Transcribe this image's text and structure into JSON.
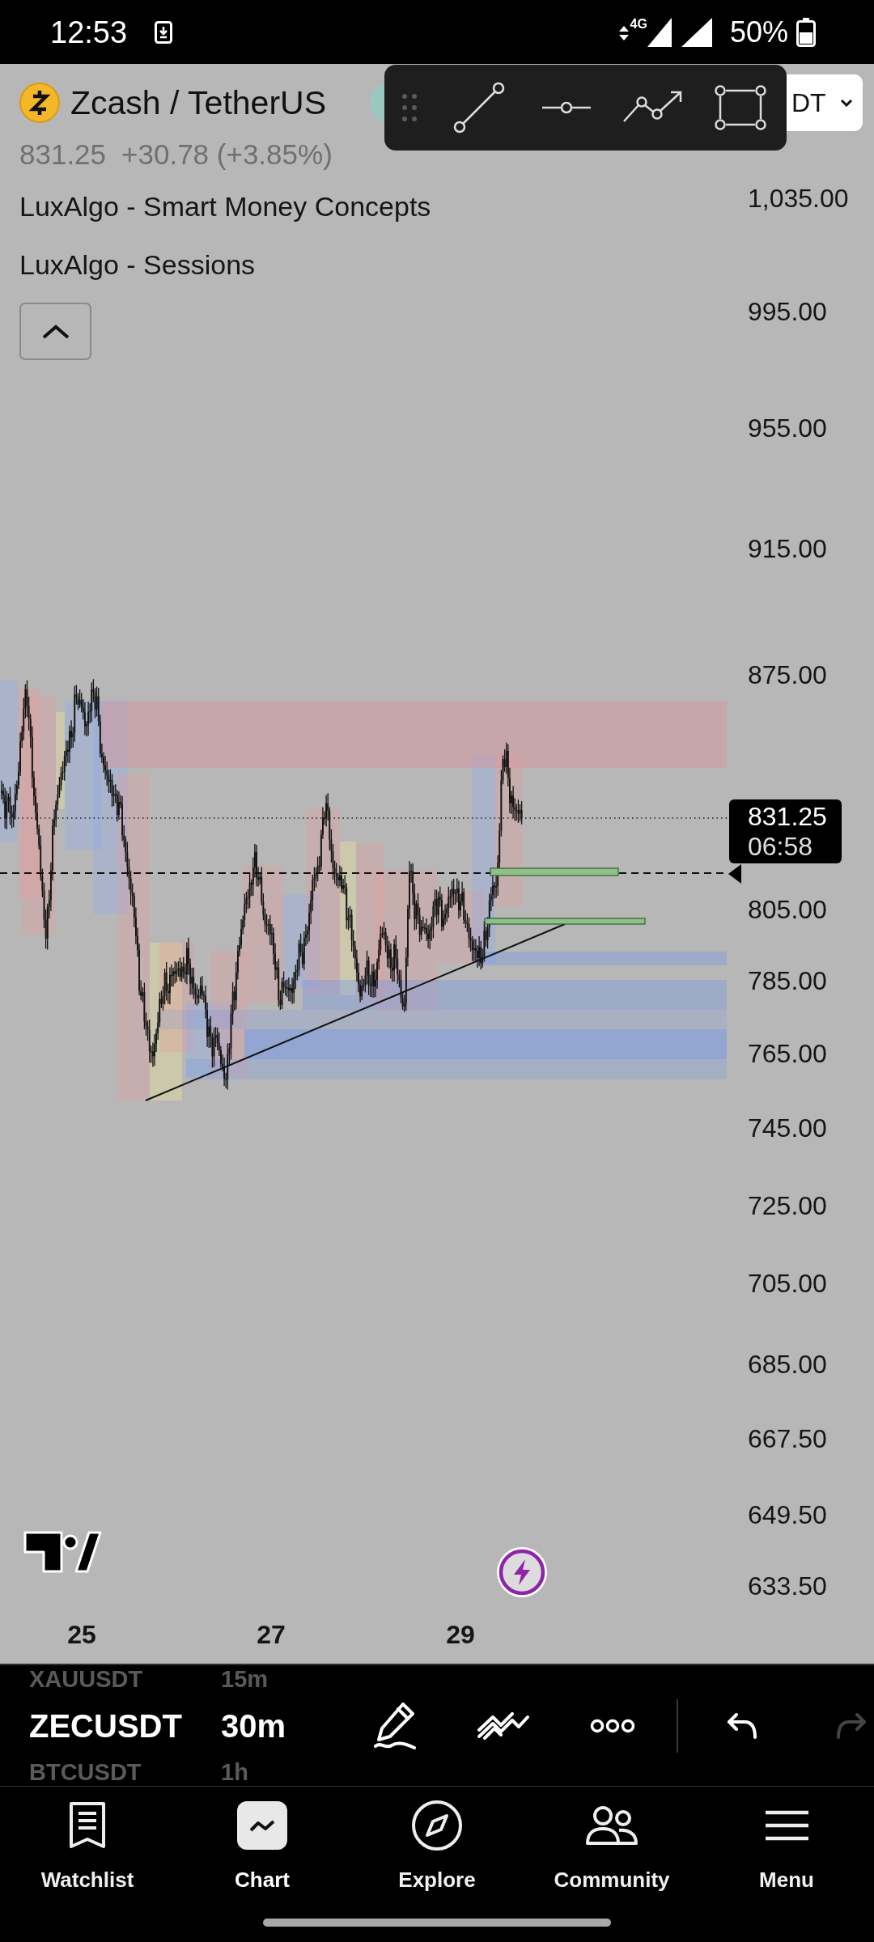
{
  "status_bar": {
    "time": "12:53",
    "network": "4G",
    "battery": "50%"
  },
  "header": {
    "symbol": "Zcash / TetherUS",
    "symbol_button": "DT",
    "price": "831.25",
    "change": "+30.78 (+3.85%)"
  },
  "indicators": [
    {
      "name": "LuxAlgo - Smart Money Concepts"
    },
    {
      "name": "LuxAlgo - Sessions"
    }
  ],
  "chart": {
    "price_axis": [
      "1,035.00",
      "995.00",
      "955.00",
      "915.00",
      "875.00",
      "805.00",
      "785.00",
      "765.00",
      "745.00",
      "725.00",
      "705.00",
      "685.00",
      "667.50",
      "649.50",
      "633.50"
    ],
    "last_price": "831.25",
    "countdown": "06:58",
    "time_axis": [
      "25",
      "27",
      "29"
    ]
  },
  "symbol_picker": {
    "symbols": [
      {
        "label": "XAUUSDT",
        "selected": false
      },
      {
        "label": "ZECUSDT",
        "selected": true
      },
      {
        "label": "BTCUSDT",
        "selected": false
      }
    ],
    "intervals": [
      {
        "label": "15m",
        "selected": false
      },
      {
        "label": "30m",
        "selected": true
      },
      {
        "label": "1h",
        "selected": false
      }
    ]
  },
  "drawing_actions": {
    "undo": {
      "disabled": false
    },
    "redo": {
      "disabled": true
    }
  },
  "nav": [
    {
      "label": "Watchlist",
      "selected": false
    },
    {
      "label": "Chart",
      "selected": true
    },
    {
      "label": "Explore",
      "selected": false
    },
    {
      "label": "Community",
      "selected": false
    },
    {
      "label": "Menu",
      "selected": false
    }
  ]
}
